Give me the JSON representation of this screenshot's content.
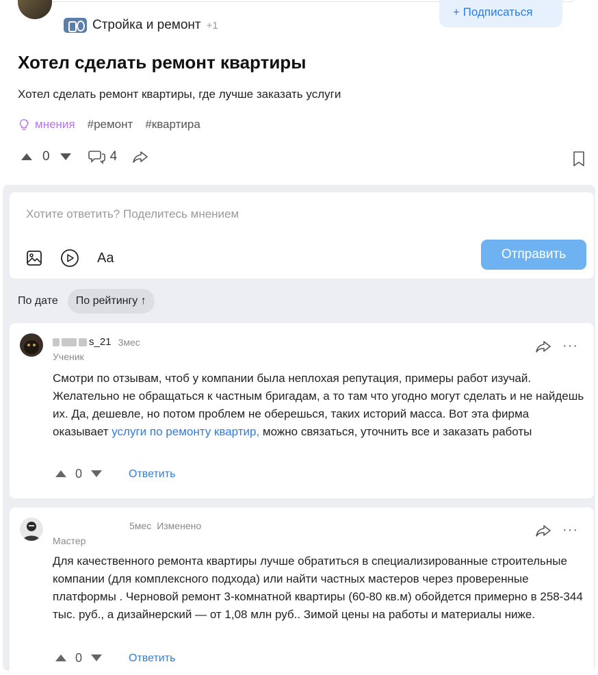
{
  "post": {
    "category": "Стройка и ремонт",
    "category_extra": "+1",
    "subscribe_label": "+ Подписаться",
    "title": "Хотел сделать ремонт квартиры",
    "text": "Хотел сделать ремонт квартиры, где лучше заказать услуги",
    "tags": {
      "opinion": "мнения",
      "list": [
        "#ремонт",
        "#квартира"
      ]
    },
    "votes": "0",
    "comments_count": "4"
  },
  "composer": {
    "placeholder": "Хотите ответить? Поделитесь мнением",
    "text_tool_label": "Aa",
    "send_label": "Отправить"
  },
  "sort": {
    "by_date": "По дате",
    "by_rating": "По рейтингу ↑"
  },
  "comments": [
    {
      "username": "s_21",
      "time": "3мес",
      "role": "Ученик",
      "text_before_link": "Смотри по отзывам, чтоб у компании была неплохая репутация, примеры работ изучай. Желательно не обращаться к частным бригадам, а то там что угодно могут сделать и не найдешь их. Да, дешевле, но потом проблем не оберешься, таких историй масса. Вот эта фирма оказывает ",
      "link_text": "услуги по ремонту квартир,",
      "text_after_link": " можно связаться, уточнить все и заказать работы",
      "votes": "0",
      "reply_label": "Ответить"
    },
    {
      "username": "",
      "time": "5мес",
      "edited": "Изменено",
      "role": "Мастер",
      "text": "Для качественного ремонта квартиры лучше обратиться в специализированные строительные компании (для комплексного подхода) или найти частных мастеров через проверенные платформы . Черновой ремонт 3-комнатной квартиры (60-80 кв.м) обойдется примерно в 258-344 тыс. руб., а дизайнерский — от 1,08 млн руб.. Зимой цены на работы и материалы ниже.",
      "votes": "0",
      "reply_label": "Ответить"
    }
  ],
  "colors": {
    "accent": "#2f7be0",
    "send_button": "#6fb2f2",
    "opinion_tag": "#b377e6",
    "section_bg": "#eceef2"
  }
}
